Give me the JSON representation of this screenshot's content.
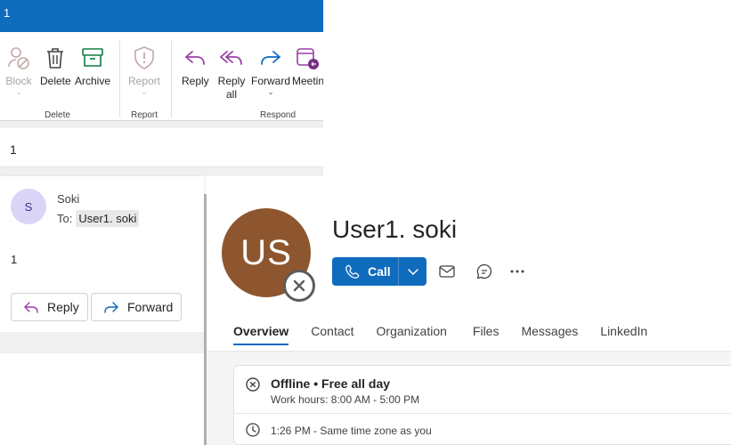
{
  "window": {
    "title": "1"
  },
  "ribbon": {
    "buttons": [
      {
        "label": "Block",
        "disabled": true
      },
      {
        "label": "Delete"
      },
      {
        "label": "Archive"
      },
      {
        "label": "Report",
        "disabled": true
      },
      {
        "label": "Reply"
      },
      {
        "label": "Reply all"
      },
      {
        "label": "Forward"
      },
      {
        "label": "Meetin"
      }
    ],
    "groups": [
      "Delete",
      "Report",
      "Respond"
    ]
  },
  "email": {
    "subject": "1",
    "sender_initial": "S",
    "sender_name": "Soki",
    "to_label": "To:",
    "to_recipient": "User1. soki",
    "body": "1",
    "reply_label": "Reply",
    "forward_label": "Forward"
  },
  "profile": {
    "initials": "US",
    "name": "User1. soki",
    "call_label": "Call",
    "tabs": [
      "Overview",
      "Contact",
      "Organization",
      "Files",
      "Messages",
      "LinkedIn"
    ],
    "active_tab": "Overview",
    "status": "Offline • Free all day",
    "work_hours": "Work hours: 8:00 AM - 5:00 PM",
    "time_zone": "1:26 PM - Same time zone as you"
  },
  "colors": {
    "accent": "#0f6cbd",
    "avatar": "#8e562e",
    "archive_green": "#107c41",
    "reply_purple": "#9b3fa6"
  }
}
